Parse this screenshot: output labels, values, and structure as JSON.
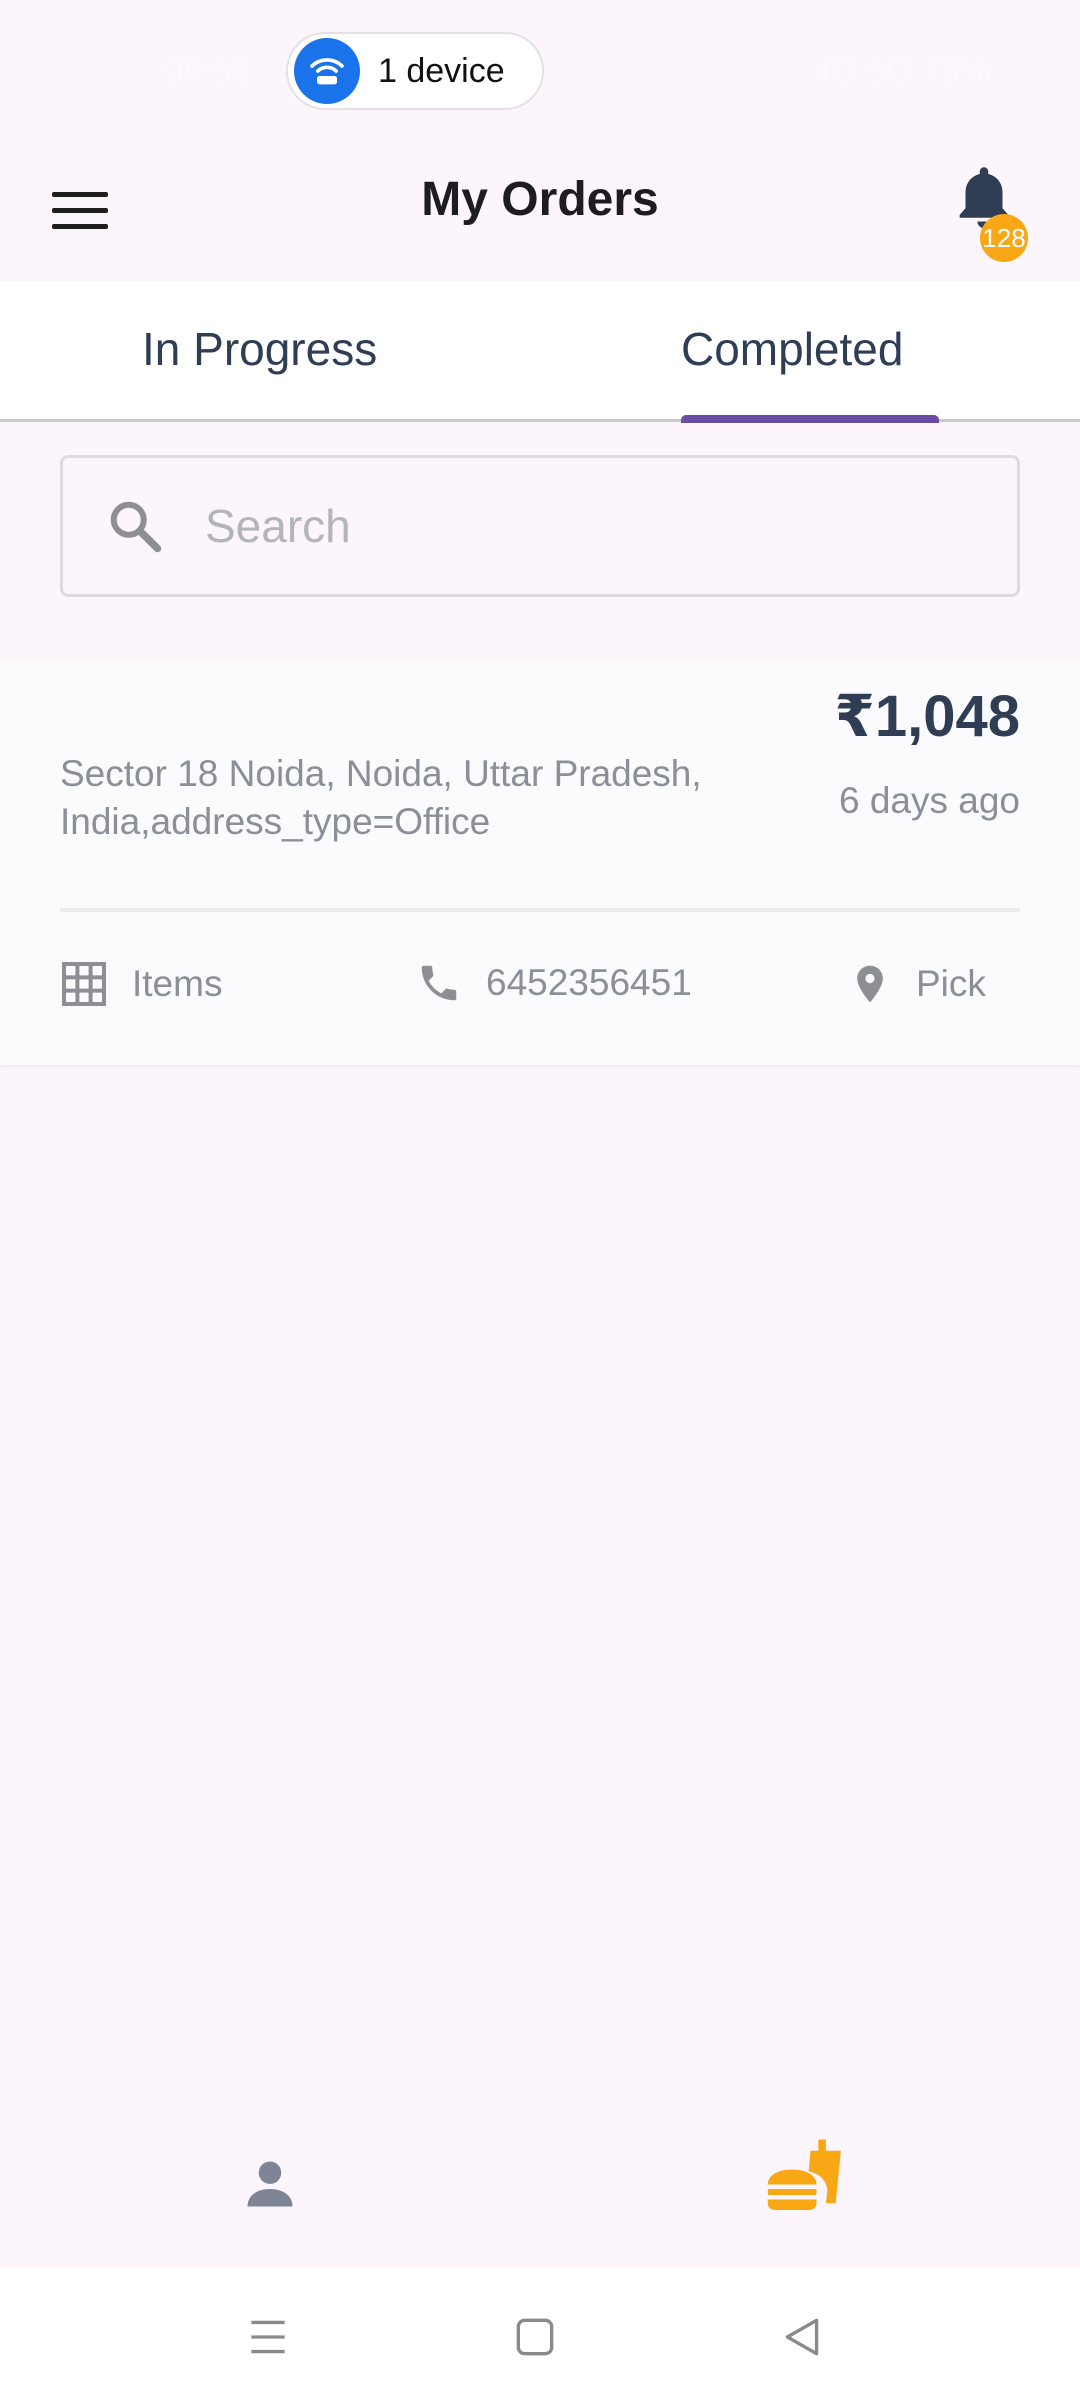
{
  "status_bar": {
    "time": "09:56",
    "right_text": "4G 5G 76%",
    "hotspot_label": "1 device"
  },
  "app_bar": {
    "title": "My Orders",
    "notification_count": "128"
  },
  "tabs": [
    {
      "label": "In Progress",
      "active": false
    },
    {
      "label": "Completed",
      "active": true
    }
  ],
  "search": {
    "placeholder": "Search",
    "value": ""
  },
  "order": {
    "amount": "₹1,048",
    "time_ago": "6 days ago",
    "address": "Sector 18 Noida, Noida, Uttar Pradesh, India,address_type=Office",
    "items_label": "Items",
    "phone": "6452356451",
    "delivery_type": "Pick"
  },
  "colors": {
    "background": "#fcf5fc",
    "primary_text": "#2f3d55",
    "accent_tab": "#6a4ea6",
    "badge": "#f8a814",
    "active_nav": "#f8a814",
    "muted_text": "#8a8f98"
  },
  "icons": {
    "menu": "hamburger-menu-icon",
    "notification": "bell-icon",
    "search": "search-icon",
    "items": "grid-icon",
    "phone": "phone-icon",
    "location": "location-pin-icon",
    "profile": "person-icon",
    "orders": "fastfood-icon"
  }
}
